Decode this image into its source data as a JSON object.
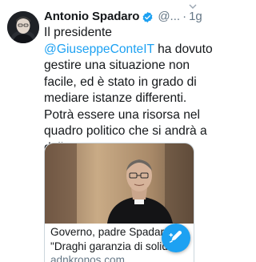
{
  "tweet": {
    "author_name": "Antonio Spadaro",
    "handle": "@...",
    "separator": "·",
    "time": "1g",
    "text": {
      "line1": "Il presidente",
      "mention": "@GiuseppeConteIT",
      "line2_rest": " ha dovuto",
      "line3": "gestire una situazione non",
      "line4": "facile, ed è stato in grado di",
      "line5": "mediare istanze differenti.",
      "line6": "Potrà essere una risorsa nel",
      "line7": "quadro politico che si andrà a",
      "line8": "delineare"
    },
    "card": {
      "title_line1": "Governo, padre Spadaro:",
      "title_line2": "\"Draghi garanzia di solidi...",
      "domain": "adnkronos.com"
    }
  },
  "icons": {
    "verified": "verified-badge-icon",
    "caret": "chevron-down-icon",
    "compose": "compose-tweet-icon"
  },
  "colors": {
    "link": "#1da1f2",
    "text": "#14171a",
    "muted": "#657786",
    "fab": "#1da1f2"
  }
}
